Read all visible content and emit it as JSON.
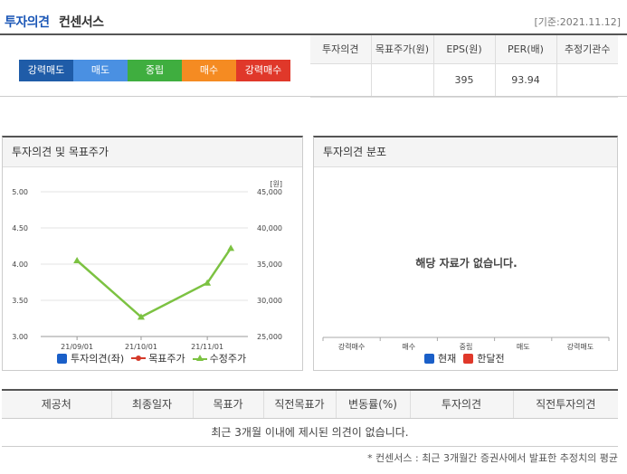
{
  "header": {
    "title_main": "투자의견",
    "title_sub": "컨센서스",
    "date": "[기준:2021.11.12]"
  },
  "rating_scale": [
    {
      "label": "강력매도",
      "color": "#1f5ca8"
    },
    {
      "label": "매도",
      "color": "#4a90e2"
    },
    {
      "label": "중립",
      "color": "#3fae3f"
    },
    {
      "label": "매수",
      "color": "#f58b22"
    },
    {
      "label": "강력매수",
      "color": "#e0382a"
    }
  ],
  "summary": {
    "headers": [
      "투자의견",
      "목표주가(원)",
      "EPS(원)",
      "PER(배)",
      "추정기관수"
    ],
    "values": [
      "",
      "",
      "395",
      "93.94",
      ""
    ]
  },
  "left_panel": {
    "title": "투자의견 및 목표주가",
    "legend": [
      {
        "label": "투자의견(좌)",
        "color": "#1a5fc8",
        "shape": "square-icon"
      },
      {
        "label": "목표주가",
        "color": "#d43a2a",
        "shape": "dot-line-icon"
      },
      {
        "label": "수정주가",
        "color": "#7cc242",
        "shape": "triangle-icon"
      }
    ]
  },
  "right_panel": {
    "title": "투자의견 분포",
    "no_data": "해당 자료가 없습니다.",
    "legend": [
      {
        "label": "현재",
        "color": "#1a5fc8"
      },
      {
        "label": "한달전",
        "color": "#e0382a"
      }
    ]
  },
  "chart_data": [
    {
      "type": "line",
      "title": "투자의견 및 목표주가",
      "x_ticks": [
        "21/09/01",
        "21/10/01",
        "21/11/01"
      ],
      "y_left_ticks": [
        "5.00",
        "4.50",
        "4.00",
        "3.50",
        "3.00"
      ],
      "y_left_range": [
        3.0,
        5.0
      ],
      "y_right_unit": "[원]",
      "y_right_ticks": [
        "45,000",
        "40,000",
        "35,000",
        "30,000",
        "25,000"
      ],
      "y_right_range": [
        25000,
        45000
      ],
      "series": [
        {
          "name": "수정주가",
          "axis": "right",
          "color": "#7cc242",
          "x": [
            "21/09/01",
            "21/10/01",
            "21/11/01",
            "21/11/12"
          ],
          "values": [
            35500,
            27700,
            32400,
            37200
          ]
        }
      ]
    },
    {
      "type": "bar",
      "title": "투자의견 분포",
      "categories": [
        "강력매수",
        "매수",
        "중립",
        "매도",
        "강력매도"
      ],
      "series": []
    }
  ],
  "list_table": {
    "headers": [
      "제공처",
      "최종일자",
      "목표가",
      "직전목표가",
      "변동률(%)",
      "투자의견",
      "직전투자의견"
    ],
    "empty_message": "최근 3개월 이내에 제시된 의견이 없습니다."
  },
  "footnote": "* 컨센서스 : 최근 3개월간 증권사에서 발표한 추정치의 평균"
}
